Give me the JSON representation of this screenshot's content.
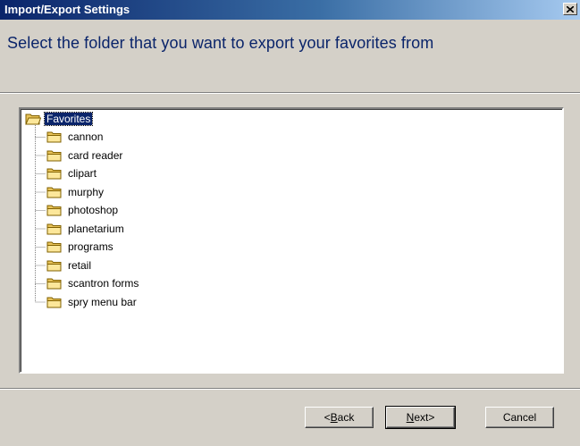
{
  "window": {
    "title": "Import/Export Settings"
  },
  "header": {
    "instruction": "Select the folder that you want to export your favorites from"
  },
  "tree": {
    "root": {
      "label": "Favorites",
      "icon": "folder-open-icon",
      "selected": true
    },
    "children": [
      {
        "label": "cannon",
        "icon": "folder-icon"
      },
      {
        "label": "card reader",
        "icon": "folder-icon"
      },
      {
        "label": "clipart",
        "icon": "folder-icon"
      },
      {
        "label": "murphy",
        "icon": "folder-icon"
      },
      {
        "label": "photoshop",
        "icon": "folder-icon"
      },
      {
        "label": "planetarium",
        "icon": "folder-icon"
      },
      {
        "label": "programs",
        "icon": "folder-icon"
      },
      {
        "label": "retail",
        "icon": "folder-icon"
      },
      {
        "label": "scantron forms",
        "icon": "folder-icon"
      },
      {
        "label": "spry menu bar",
        "icon": "folder-icon"
      }
    ]
  },
  "buttons": {
    "back": {
      "mnemonic": "B",
      "rest": "ack",
      "prefix": "< "
    },
    "next": {
      "mnemonic": "N",
      "rest": "ext",
      "suffix": " >"
    },
    "cancel": {
      "label": "Cancel"
    }
  },
  "colors": {
    "title_bar_start": "#0a246a",
    "title_bar_end": "#a6caf0",
    "dialog_face": "#d4d0c8",
    "instruction_text": "#0a246a",
    "selection": "#0a246a"
  }
}
